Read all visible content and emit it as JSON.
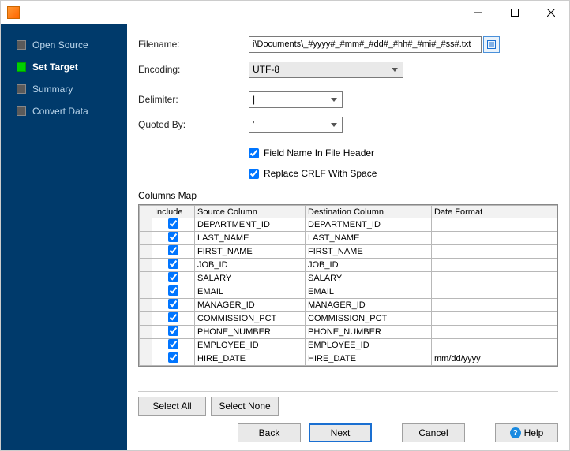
{
  "sidebar": {
    "items": [
      {
        "label": "Open Source"
      },
      {
        "label": "Set Target"
      },
      {
        "label": "Summary"
      },
      {
        "label": "Convert Data"
      }
    ],
    "active_index": 1
  },
  "form": {
    "filename_label": "Filename:",
    "filename_value": "i\\Documents\\_#yyyy#_#mm#_#dd#_#hh#_#mi#_#ss#.txt",
    "encoding_label": "Encoding:",
    "encoding_value": "UTF-8",
    "delimiter_label": "Delimiter:",
    "delimiter_value": "|",
    "quoted_label": "Quoted By:",
    "quoted_value": "'",
    "chk_header_label": "Field Name In File Header",
    "chk_header_checked": true,
    "chk_crlf_label": "Replace CRLF With Space",
    "chk_crlf_checked": true
  },
  "columns_map": {
    "title": "Columns Map",
    "headers": {
      "include": "Include",
      "source": "Source Column",
      "dest": "Destination Column",
      "format": "Date Format"
    },
    "rows": [
      {
        "include": true,
        "source": "DEPARTMENT_ID",
        "dest": "DEPARTMENT_ID",
        "format": ""
      },
      {
        "include": true,
        "source": "LAST_NAME",
        "dest": "LAST_NAME",
        "format": ""
      },
      {
        "include": true,
        "source": "FIRST_NAME",
        "dest": "FIRST_NAME",
        "format": ""
      },
      {
        "include": true,
        "source": "JOB_ID",
        "dest": "JOB_ID",
        "format": ""
      },
      {
        "include": true,
        "source": "SALARY",
        "dest": "SALARY",
        "format": ""
      },
      {
        "include": true,
        "source": "EMAIL",
        "dest": "EMAIL",
        "format": ""
      },
      {
        "include": true,
        "source": "MANAGER_ID",
        "dest": "MANAGER_ID",
        "format": ""
      },
      {
        "include": true,
        "source": "COMMISSION_PCT",
        "dest": "COMMISSION_PCT",
        "format": ""
      },
      {
        "include": true,
        "source": "PHONE_NUMBER",
        "dest": "PHONE_NUMBER",
        "format": ""
      },
      {
        "include": true,
        "source": "EMPLOYEE_ID",
        "dest": "EMPLOYEE_ID",
        "format": ""
      },
      {
        "include": true,
        "source": "HIRE_DATE",
        "dest": "HIRE_DATE",
        "format": "mm/dd/yyyy"
      }
    ]
  },
  "buttons": {
    "select_all": "Select All",
    "select_none": "Select None",
    "back": "Back",
    "next": "Next",
    "cancel": "Cancel",
    "help": "Help"
  }
}
